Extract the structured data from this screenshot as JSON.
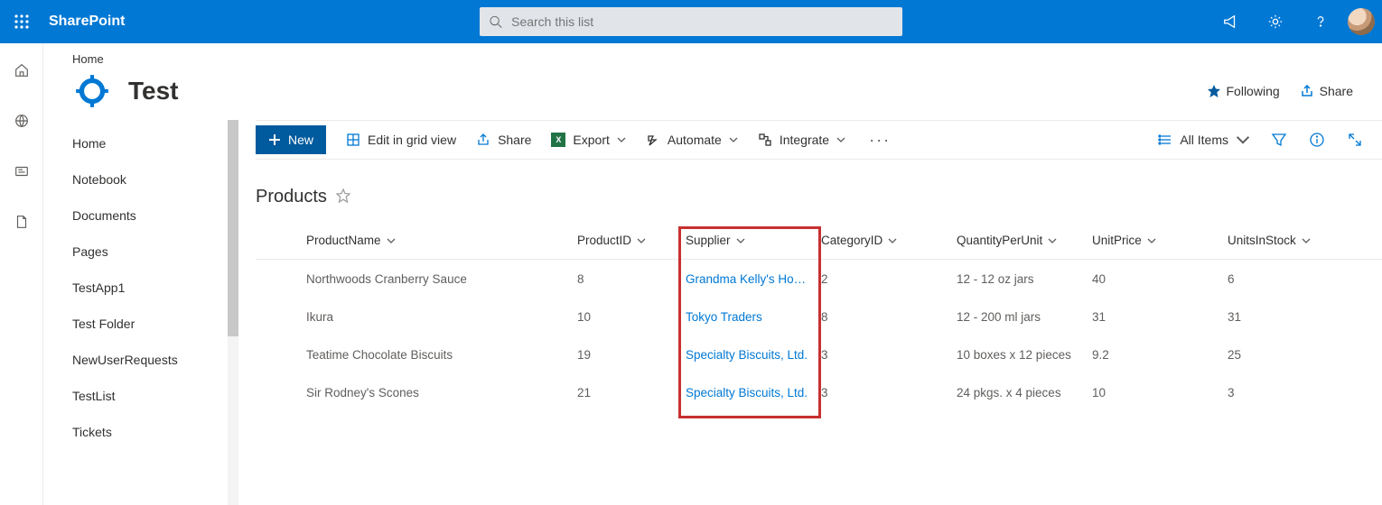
{
  "suite": {
    "brand": "SharePoint",
    "search_placeholder": "Search this list"
  },
  "breadcrumb": "Home",
  "site": {
    "title": "Test",
    "following_label": "Following",
    "share_label": "Share"
  },
  "sidenav": {
    "items": [
      {
        "label": "Home"
      },
      {
        "label": "Notebook"
      },
      {
        "label": "Documents"
      },
      {
        "label": "Pages"
      },
      {
        "label": "TestApp1"
      },
      {
        "label": "Test Folder"
      },
      {
        "label": "NewUserRequests"
      },
      {
        "label": "TestList"
      },
      {
        "label": "Tickets"
      }
    ]
  },
  "cmdbar": {
    "new": "New",
    "edit_grid": "Edit in grid view",
    "share": "Share",
    "export": "Export",
    "automate": "Automate",
    "integrate": "Integrate",
    "view_label": "All Items"
  },
  "list": {
    "title": "Products",
    "columns": [
      {
        "key": "ProductName",
        "label": "ProductName"
      },
      {
        "key": "ProductID",
        "label": "ProductID"
      },
      {
        "key": "Supplier",
        "label": "Supplier"
      },
      {
        "key": "CategoryID",
        "label": "CategoryID"
      },
      {
        "key": "QuantityPerUnit",
        "label": "QuantityPerUnit"
      },
      {
        "key": "UnitPrice",
        "label": "UnitPrice"
      },
      {
        "key": "UnitsInStock",
        "label": "UnitsInStock"
      }
    ],
    "rows": [
      {
        "ProductName": "Northwoods Cranberry Sauce",
        "ProductID": "8",
        "Supplier": "Grandma Kelly's Homestead",
        "CategoryID": "2",
        "QuantityPerUnit": "12 - 12 oz jars",
        "UnitPrice": "40",
        "UnitsInStock": "6"
      },
      {
        "ProductName": "Ikura",
        "ProductID": "10",
        "Supplier": "Tokyo Traders",
        "CategoryID": "8",
        "QuantityPerUnit": "12 - 200 ml jars",
        "UnitPrice": "31",
        "UnitsInStock": "31"
      },
      {
        "ProductName": "Teatime Chocolate Biscuits",
        "ProductID": "19",
        "Supplier": "Specialty Biscuits, Ltd.",
        "CategoryID": "3",
        "QuantityPerUnit": "10 boxes x 12 pieces",
        "UnitPrice": "9.2",
        "UnitsInStock": "25"
      },
      {
        "ProductName": "Sir Rodney's Scones",
        "ProductID": "21",
        "Supplier": "Specialty Biscuits, Ltd.",
        "CategoryID": "3",
        "QuantityPerUnit": "24 pkgs. x 4 pieces",
        "UnitPrice": "10",
        "UnitsInStock": "3"
      }
    ]
  },
  "highlight": {
    "column": "Supplier"
  }
}
